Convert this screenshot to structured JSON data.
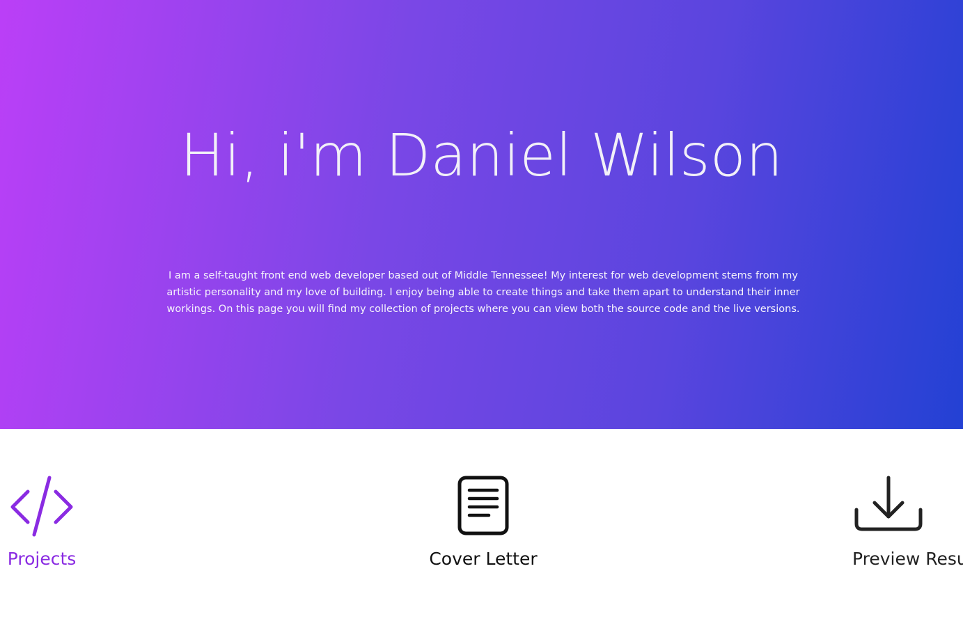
{
  "hero": {
    "title": "Hi, i'm Daniel Wilson",
    "bio": "I am a self-taught front end web developer based out of Middle Tennessee! My interest for web development stems from my artistic personality and my love of building. I enjoy being able to create things and take them apart to understand their inner workings. On this page you will find my collection of projects where you can view both the source code and the live versions."
  },
  "links": [
    {
      "label": "Projects",
      "icon": "code-icon",
      "color": "#8a2be2"
    },
    {
      "label": "Cover Letter",
      "icon": "document-icon",
      "color": "#111111"
    },
    {
      "label": "Preview Resume",
      "icon": "download-icon",
      "color": "#222222"
    }
  ],
  "colors": {
    "gradient_start": "#bb3ff7",
    "gradient_end": "#2341d4",
    "accent": "#8a2be2"
  }
}
